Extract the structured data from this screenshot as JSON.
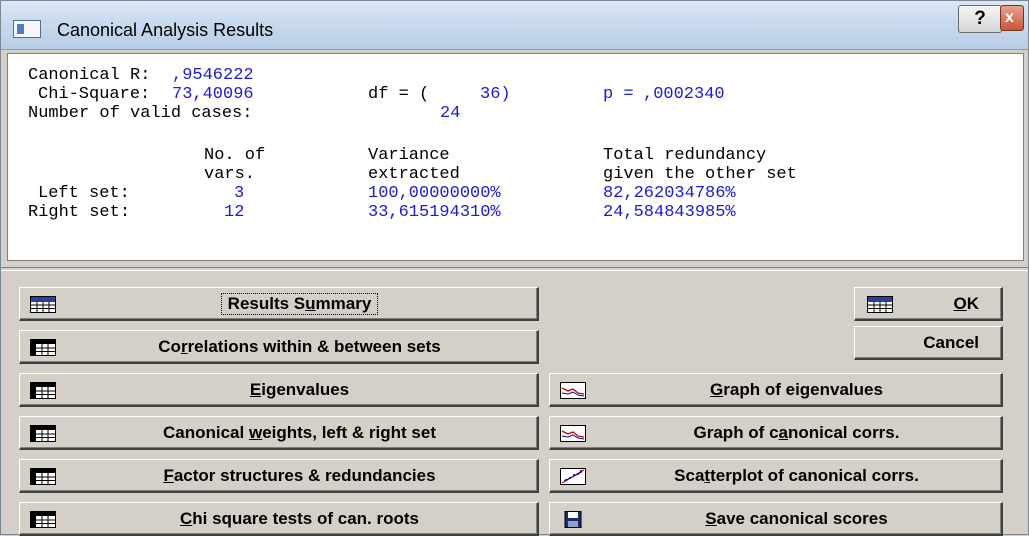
{
  "window": {
    "title": "Canonical Analysis Results",
    "help_label": "?",
    "close_label": "x"
  },
  "output": {
    "line1_label": "Canonical R:",
    "canonical_r": ",9546222",
    "chi_label": "Chi-Square:",
    "chi_square": "73,40096",
    "df_label": "df = (",
    "df_value": "36)",
    "p_label": "p =",
    "p_value": ",0002340",
    "valid_label": "Number of valid cases:",
    "valid_cases": "24",
    "headers": {
      "col1_line1": "No. of",
      "col1_line2": "vars.",
      "col2_line1": "Variance",
      "col2_line2": "extracted",
      "col3_line1": "Total redundancy",
      "col3_line2": "given the other set"
    },
    "rows": [
      {
        "label": "Left set:",
        "vars": "3",
        "variance": "100,00000000%",
        "redundancy": "82,262034786%"
      },
      {
        "label": "Right set:",
        "vars": "12",
        "variance": "33,615194310%",
        "redundancy": "24,584843985%"
      }
    ]
  },
  "buttons": {
    "results_summary": {
      "pre": "Results S",
      "ul": "u",
      "post": "mmary"
    },
    "correlations": {
      "pre": "Co",
      "ul": "r",
      "post": "relations within & between sets"
    },
    "eigenvalues": {
      "pre": "",
      "ul": "E",
      "post": "igenvalues"
    },
    "canonical_weights": {
      "pre": "Canonical ",
      "ul": "w",
      "post": "eights, left & right set"
    },
    "factor_structures": {
      "pre": "",
      "ul": "F",
      "post": "actor structures & redundancies"
    },
    "chi_square_tests": {
      "pre": "",
      "ul": "C",
      "post": "hi square tests of can. roots"
    },
    "ok": {
      "pre": "",
      "ul": "O",
      "post": "K"
    },
    "cancel": {
      "pre": "Cancel",
      "ul": "",
      "post": ""
    },
    "graph_eigenvalues": {
      "pre": "",
      "ul": "G",
      "post": "raph of eigenvalues"
    },
    "graph_canonical_corrs": {
      "pre": "Graph of c",
      "ul": "a",
      "post": "nonical corrs."
    },
    "scatterplot": {
      "pre": "Sca",
      "ul": "t",
      "post": "terplot of canonical corrs."
    },
    "save_scores": {
      "pre": "",
      "ul": "S",
      "post": "ave canonical scores"
    }
  },
  "icons": {
    "summary_icon": "summary-grid-icon",
    "table_icon": "spreadsheet-icon",
    "graph_icon": "line-graph-icon",
    "scatter_icon": "scatterplot-icon",
    "save_icon": "floppy-disk-icon"
  }
}
